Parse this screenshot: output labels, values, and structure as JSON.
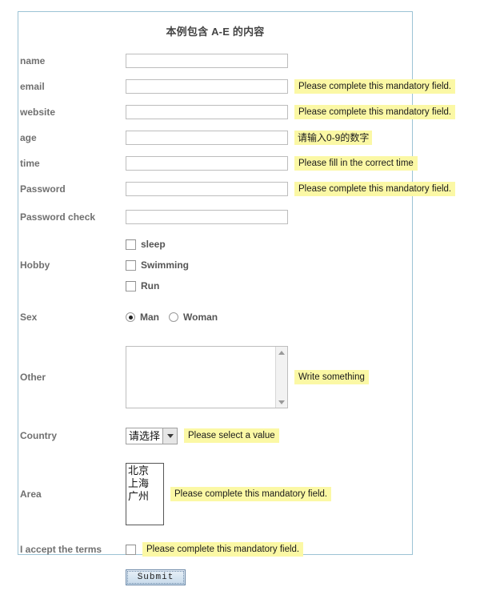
{
  "form": {
    "title": "本例包含 A-E 的内容",
    "accent_border_color": "#9cc3d5",
    "hint_background_color": "#fbf8a5",
    "label_color": "#707070",
    "rows": {
      "name": {
        "label": "name"
      },
      "email": {
        "label": "email",
        "hint": "Please complete this mandatory field."
      },
      "website": {
        "label": "website",
        "hint": "Please complete this mandatory field."
      },
      "age": {
        "label": "age",
        "hint": "请输入0-9的数字"
      },
      "time": {
        "label": "time",
        "hint": "Please fill in the correct time"
      },
      "password": {
        "label": "Password",
        "hint": "Please complete this mandatory field."
      },
      "password_check": {
        "label": "Password check"
      },
      "hobby": {
        "label": "Hobby"
      },
      "sex": {
        "label": "Sex"
      },
      "other": {
        "label": "Other",
        "hint": "Write something"
      },
      "country": {
        "label": "Country",
        "hint": "Please select a value"
      },
      "area": {
        "label": "Area",
        "hint": "Please complete this mandatory field."
      },
      "terms": {
        "label": "I accept the terms",
        "hint": "Please complete this mandatory field."
      }
    },
    "inputs": {
      "name_value": "",
      "email_value": "",
      "website_value": "",
      "age_value": "",
      "time_value": "",
      "password_value": "",
      "password_check_value": "",
      "other_value": ""
    },
    "hobby_options": [
      {
        "label": "sleep",
        "checked": false
      },
      {
        "label": "Swimming",
        "checked": false
      },
      {
        "label": "Run",
        "checked": false
      }
    ],
    "sex_options": [
      {
        "label": "Man",
        "checked": true
      },
      {
        "label": "Woman",
        "checked": false
      }
    ],
    "country_select": {
      "selected": "请选择",
      "options": [
        "请选择"
      ]
    },
    "area_listbox": {
      "options": [
        "北京",
        "上海",
        "广州"
      ],
      "selected": []
    },
    "terms_checkbox": {
      "checked": false
    },
    "submit": {
      "label": "Submit"
    }
  }
}
